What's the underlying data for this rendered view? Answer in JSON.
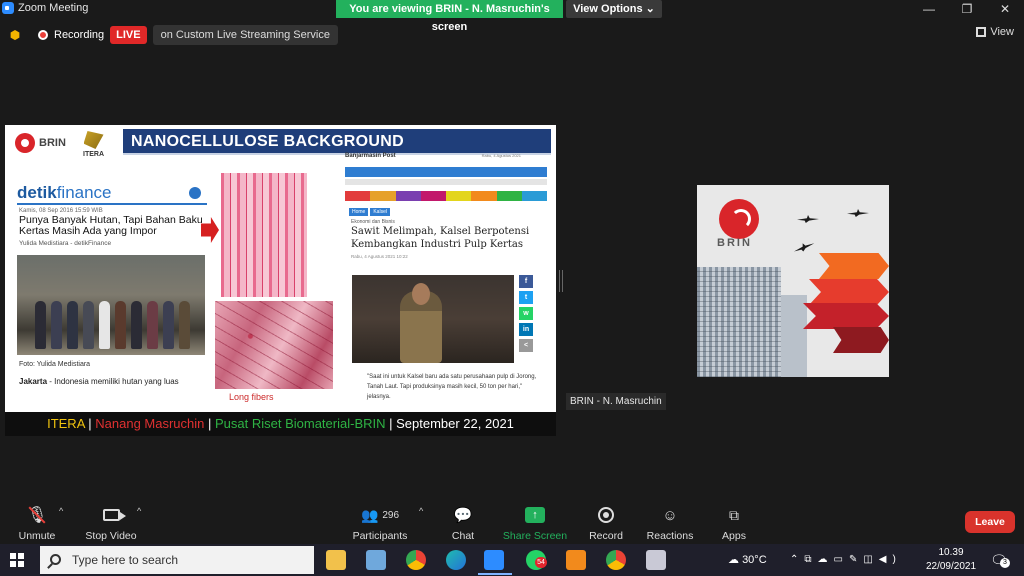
{
  "window": {
    "title": "Zoom Meeting",
    "viewing_banner": "You are viewing BRIN - N. Masruchin's screen",
    "view_options": "View Options",
    "minimize": "—",
    "restore": "❐",
    "close": "✕"
  },
  "top_bar": {
    "recording": "Recording",
    "live": "LIVE",
    "stream_service": "on Custom Live Streaming Service",
    "view": "View"
  },
  "slide": {
    "brin_logo_text": "BRIN",
    "itera_logo_text": "ITERA",
    "title": "NANOCELLULOSE BACKGROUND",
    "detik": {
      "logo_main": "detik",
      "logo_sub": "finance",
      "date": "Kamis, 08 Sep 2016 15:59 WIB",
      "headline": "Punya Banyak Hutan, Tapi Bahan Baku Kertas Masih Ada yang Impor",
      "author": "Yulida Medistiara - detikFinance",
      "photo_caption": "Foto: Yulida Medistiara",
      "body_bold": "Jakarta",
      "body_rest": " - Indonesia memiliki hutan yang luas"
    },
    "long_fibers": "Long fibers",
    "banjar": {
      "site_name": "Banjarmasin Post",
      "date": "Rabu, 4 Agustus 2021",
      "bread_home": "Home",
      "bread_section": "Kalsel",
      "kicker": "Ekonomi dan Bisnis",
      "headline": "Sawit Melimpah, Kalsel Berpotensi Kembangkan Industri Pulp Kertas",
      "meta": "Rabu, 4 Agustus 2021 10:22",
      "quote": "\"Saat ini untuk Kalsel baru ada satu perusahaan pulp di Jorong, Tanah Laut. Tapi produksinya masih kecil, 50 ton per hari,\" jelasnya."
    },
    "footer": {
      "part1": "ITERA",
      "sep1": " | ",
      "part2": "Nanang Masruchin",
      "sep2": " | ",
      "part3": "Pusat Riset Biomaterial-BRIN",
      "sep3": " | ",
      "part4": "September 22, 2021"
    }
  },
  "video_tile": {
    "logo_text": "BRIN",
    "participant_label": "BRIN - N. Masruchin"
  },
  "toolbar": {
    "unmute": "Unmute",
    "stop_video": "Stop Video",
    "participants": "Participants",
    "participants_count": "296",
    "chat": "Chat",
    "share_screen": "Share Screen",
    "record": "Record",
    "reactions": "Reactions",
    "apps": "Apps",
    "leave": "Leave"
  },
  "taskbar": {
    "search_placeholder": "Type here to search",
    "whatsapp_badge": "54",
    "temperature": "30°C",
    "time": "10.39",
    "date": "22/09/2021",
    "notifications": "3"
  },
  "colors": {
    "share_green": "#23b15d",
    "live_red": "#e02828",
    "leave_red": "#d9332c",
    "slide_title_bg": "#1f3e7a"
  }
}
